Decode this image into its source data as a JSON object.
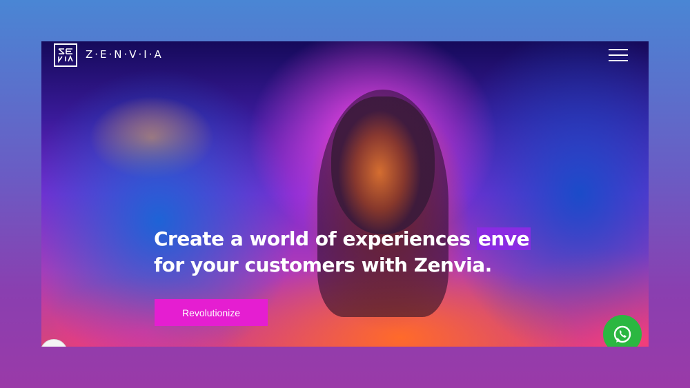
{
  "header": {
    "brand_name": "Z·E·N·V·I·A",
    "logo_lettering": "ZEN VIA",
    "menu_icon": "hamburger-menu-icon"
  },
  "hero": {
    "headline_line1": "Create a world of experiences ",
    "headline_highlight": "enve",
    "headline_line2": "for your customers with Zenvia.",
    "highlight_color": "#8a2be2",
    "cta_label": "Revolutionize",
    "cta_color": "#e51ed1"
  },
  "floating": {
    "whatsapp_icon": "whatsapp-icon",
    "whatsapp_color": "#2bb741",
    "chat_badge_icon": "chat-badge-icon"
  }
}
